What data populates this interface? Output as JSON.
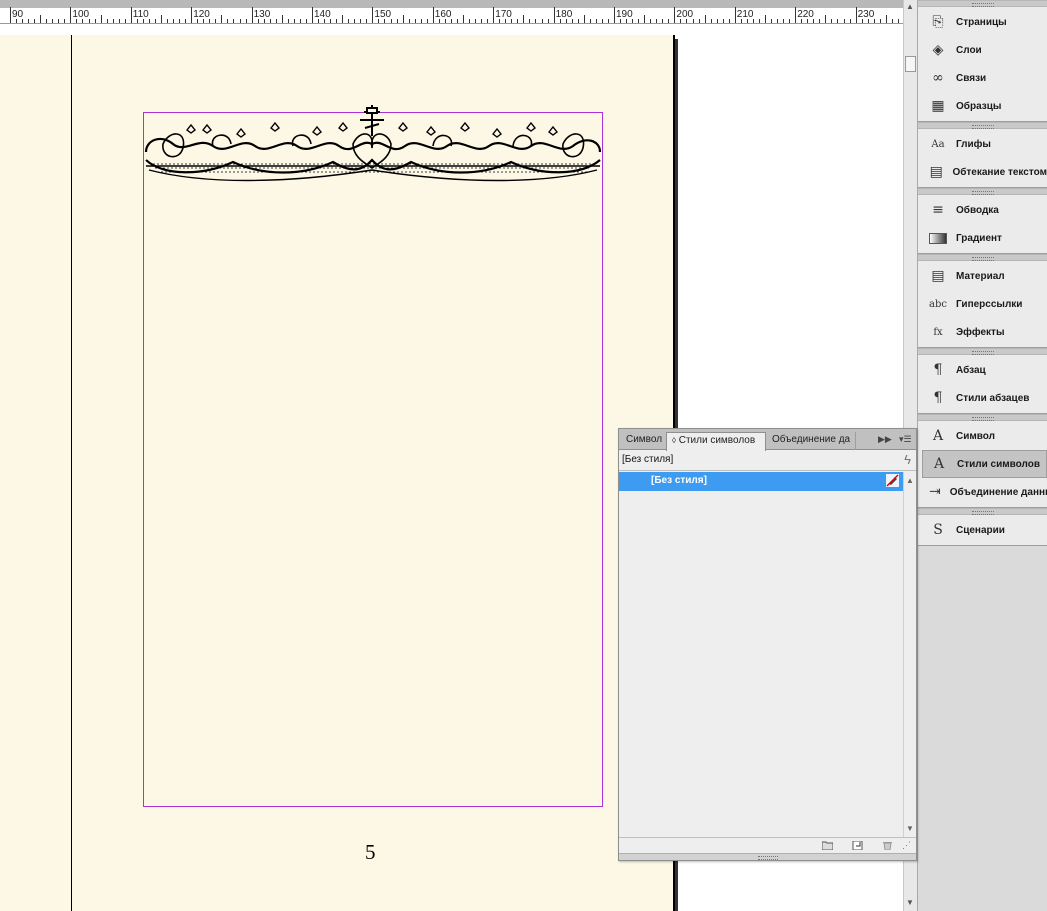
{
  "ruler": {
    "labels": [
      "90",
      "100",
      "110",
      "120",
      "130",
      "140",
      "150",
      "160",
      "170",
      "180",
      "190",
      "200",
      "210",
      "220",
      "230"
    ]
  },
  "document": {
    "page_number": "5"
  },
  "dock": {
    "groups": [
      [
        {
          "label": "Страницы",
          "icon": "pages-icon"
        },
        {
          "label": "Слои",
          "icon": "layers-icon"
        },
        {
          "label": "Связи",
          "icon": "links-icon"
        },
        {
          "label": "Образцы",
          "icon": "swatches-icon"
        }
      ],
      [
        {
          "label": "Глифы",
          "icon": "glyphs-icon"
        },
        {
          "label": "Обтекание текстом",
          "icon": "text-wrap-icon"
        }
      ],
      [
        {
          "label": "Обводка",
          "icon": "stroke-icon"
        },
        {
          "label": "Градиент",
          "icon": "gradient-icon"
        }
      ],
      [
        {
          "label": "Материал",
          "icon": "content-icon"
        },
        {
          "label": "Гиперссылки",
          "icon": "hyperlinks-icon"
        },
        {
          "label": "Эффекты",
          "icon": "effects-icon"
        }
      ],
      [
        {
          "label": "Абзац",
          "icon": "paragraph-icon"
        },
        {
          "label": "Стили абзацев",
          "icon": "paragraph-styles-icon"
        }
      ],
      [
        {
          "label": "Символ",
          "icon": "character-icon"
        },
        {
          "label": "Стили символов",
          "icon": "character-styles-icon",
          "active": true
        },
        {
          "label": "Объединение данных",
          "icon": "data-merge-icon"
        }
      ],
      [
        {
          "label": "Сценарии",
          "icon": "scripts-icon"
        }
      ]
    ]
  },
  "panel": {
    "tabs": [
      "Символ",
      "Стили символов",
      "Объединение да"
    ],
    "active_tab": "Стили символов",
    "current_style": "[Без стиля]",
    "rows": [
      {
        "label": "[Без стиля]",
        "selected": true
      }
    ],
    "selection_color": "#3d9cf2"
  },
  "colors": {
    "page": "#fdf8e6",
    "margin_guide": "#b030d8",
    "dock_bg": "#dadada"
  }
}
